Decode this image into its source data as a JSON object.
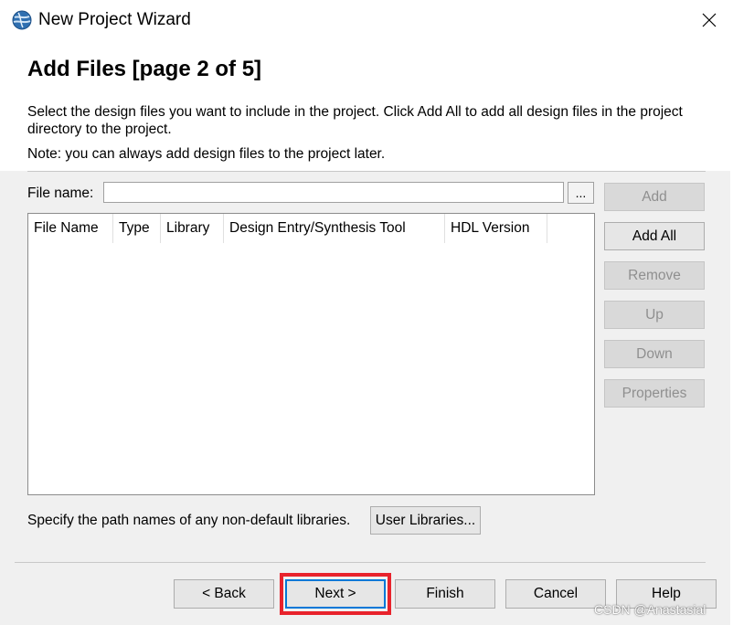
{
  "window": {
    "title": "New Project Wizard",
    "icon": "globe-icon",
    "close": "close-icon"
  },
  "header": {
    "heading": "Add Files [page 2 of 5]",
    "description": "Select the design files you want to include in the project. Click Add All to add all design files in the project directory to the project.",
    "note": "Note: you can always add design files to the project later."
  },
  "file_name": {
    "label": "File name:",
    "value": "",
    "browse_label": "..."
  },
  "table": {
    "columns": [
      "File Name",
      "Type",
      "Library",
      "Design Entry/Synthesis Tool",
      "HDL Version"
    ],
    "rows": []
  },
  "side_buttons": [
    {
      "label": "Add",
      "enabled": false
    },
    {
      "label": "Add All",
      "enabled": true
    },
    {
      "label": "Remove",
      "enabled": false
    },
    {
      "label": "Up",
      "enabled": false
    },
    {
      "label": "Down",
      "enabled": false
    },
    {
      "label": "Properties",
      "enabled": false
    }
  ],
  "libraries": {
    "text": "Specify the path names of any non-default libraries.",
    "button": "User Libraries..."
  },
  "footer": {
    "back": "< Back",
    "next": "Next >",
    "finish": "Finish",
    "cancel": "Cancel",
    "help": "Help"
  },
  "watermark": "CSDN @Anastasial",
  "colors": {
    "highlight": "#e8232c",
    "focus": "#0078d7"
  }
}
